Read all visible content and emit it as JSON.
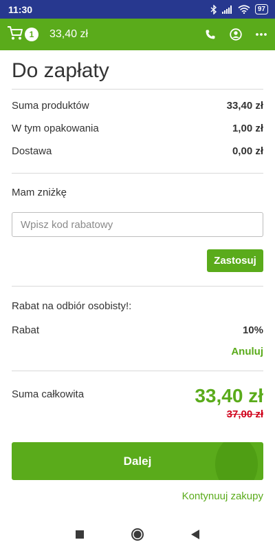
{
  "status_bar": {
    "time": "11:30",
    "battery": "97",
    "icons": [
      "bluetooth-icon",
      "signal-icon",
      "wifi-icon",
      "battery-icon"
    ]
  },
  "app_bar": {
    "cart_count": "1",
    "cart_amount": "33,40 zł",
    "actions": [
      "phone-icon",
      "account-icon",
      "more-icon"
    ]
  },
  "page": {
    "title": "Do zapłaty",
    "summary": [
      {
        "label": "Suma produktów",
        "value": "33,40 zł"
      },
      {
        "label": "W tym opakowania",
        "value": "1,00 zł"
      },
      {
        "label": "Dostawa",
        "value": "0,00 zł"
      }
    ],
    "discount": {
      "label": "Mam zniżkę",
      "placeholder": "Wpisz kod rabatowy",
      "value": "",
      "apply_label": "Zastosuj"
    },
    "promo": {
      "title": "Rabat na odbiór osobisty!:",
      "rabat_label": "Rabat",
      "rabat_value": "10%",
      "cancel_label": "Anuluj"
    },
    "total": {
      "label": "Suma całkowita",
      "value": "33,40 zł",
      "old_value": "37,00 zł"
    },
    "next_label": "Dalej",
    "continue_label": "Kontynuuj zakupy"
  },
  "nav_bar": [
    "recents-icon",
    "home-icon",
    "back-icon"
  ],
  "colors": {
    "brand_green": "#5aab1b",
    "status_bar": "#27388f",
    "old_price_red": "#d0021b"
  }
}
